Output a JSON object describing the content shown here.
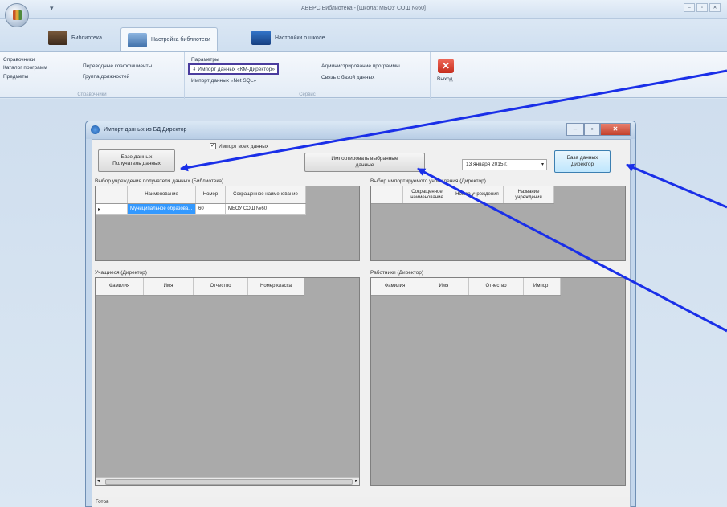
{
  "app": {
    "title": "АВЕРС:Библиотека - [Школа: МБОУ СОШ №60]",
    "quick_access": "▾",
    "window_controls": [
      "–",
      "▫",
      "✕"
    ]
  },
  "ribbon": {
    "tabs": [
      {
        "label": "Библиотека"
      },
      {
        "label": "Настройка библиотеки"
      },
      {
        "label": "Настройки о школе"
      }
    ],
    "groups": {
      "ref": {
        "label": "Справочники",
        "items": [
          "Справочники",
          "Каталог программ",
          "Предметы",
          "Переводные коэффициенты",
          "Группа должностей"
        ]
      },
      "service": {
        "label": "Сервис",
        "items": [
          "Параметры",
          "Импорт данных «КМ-Директор»",
          "Импорт данных «Net SQL»",
          "Администрирование программы",
          "Связь с базой данных"
        ]
      },
      "exit_label": "Выход"
    }
  },
  "dialog": {
    "title": "Импорт данных из БД Директор",
    "controls": {
      "min": "–",
      "max": "▫",
      "close": "✕"
    },
    "btn_get_data": "Базе данных\nПолучатель данных",
    "checkbox_label": "Импорт всех данных",
    "checkbox_mark": "✓",
    "btn_import_selected": "Импортировать выбранные\nданные",
    "date_value": "13  января  2015 г.",
    "date_dropdown": "▾",
    "btn_director_db": "База данных\nДиректор",
    "panel_library_label": "Выбор учреждения получателя данных (Библиотека)",
    "library_grid": {
      "headers": [
        "Наименование",
        "Номер",
        "Сокращенное наименование"
      ],
      "rows": [
        {
          "marker": "▸",
          "name": "Муниципальное образова...",
          "number": "60",
          "short": "МБОУ СОШ №60"
        }
      ]
    },
    "panel_director_label": "Выбор импортируемого учреждения (Директор)",
    "director_grid": {
      "headers": [
        "Сокращенное наименование",
        "Номер учреждения",
        "Название учреждения"
      ]
    },
    "panel_students_label": "Учащиеся (Директор)",
    "students_grid": {
      "headers": [
        "Фамилия",
        "Имя",
        "Отчество",
        "Номер класса"
      ],
      "scroll_left": "◂",
      "scroll_right": "▸"
    },
    "panel_workers_label": "Работники (Директор)",
    "workers_grid": {
      "headers": [
        "Фамилия",
        "Имя",
        "Отчество",
        "Импорт"
      ]
    },
    "status": "Готов"
  },
  "colors": {
    "annotation_arrow": "#1a2fe8",
    "selection": "#3399ff",
    "highlight_border": "#4a3c9e"
  }
}
